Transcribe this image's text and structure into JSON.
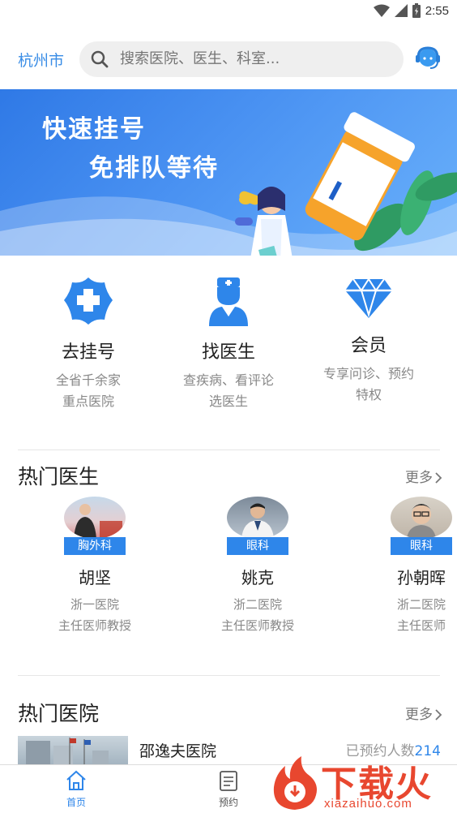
{
  "status": {
    "time": "2:55"
  },
  "header": {
    "city": "杭州市",
    "search_placeholder": "搜索医院、医生、科室..."
  },
  "banner": {
    "line1": "快速挂号",
    "line2": "免排队等待"
  },
  "features": [
    {
      "title": "去挂号",
      "desc1": "全省千余家",
      "desc2": "重点医院",
      "icon": "hospital-cross-icon"
    },
    {
      "title": "找医生",
      "desc1": "查疾病、看评论",
      "desc2": "选医生",
      "icon": "doctor-icon"
    },
    {
      "title": "会员",
      "desc1": "专享问诊、预约",
      "desc2": "特权",
      "icon": "diamond-icon"
    }
  ],
  "hot_doctors": {
    "title": "热门医生",
    "more": "更多",
    "items": [
      {
        "dept": "胸外科",
        "name": "胡坚",
        "hospital": "浙一医院",
        "title": "主任医师教授"
      },
      {
        "dept": "眼科",
        "name": "姚克",
        "hospital": "浙二医院",
        "title": "主任医师教授"
      },
      {
        "dept": "眼科",
        "name": "孙朝晖",
        "hospital": "浙二医院",
        "title": "主任医师"
      }
    ]
  },
  "hot_hospitals": {
    "title": "热门医院",
    "more": "更多",
    "items": [
      {
        "name": "邵逸夫医院",
        "count_label": "已预约人数",
        "count": "214"
      }
    ]
  },
  "bottom_nav": [
    {
      "label": "首页",
      "icon": "home-icon",
      "active": true
    },
    {
      "label": "预约",
      "icon": "clipboard-icon",
      "active": false
    }
  ],
  "watermark": {
    "text": "下载火",
    "url": "xiazaihuo.com"
  },
  "colors": {
    "accent": "#2e86ea",
    "city": "#3a8de6",
    "watermark": "#e8472f"
  }
}
